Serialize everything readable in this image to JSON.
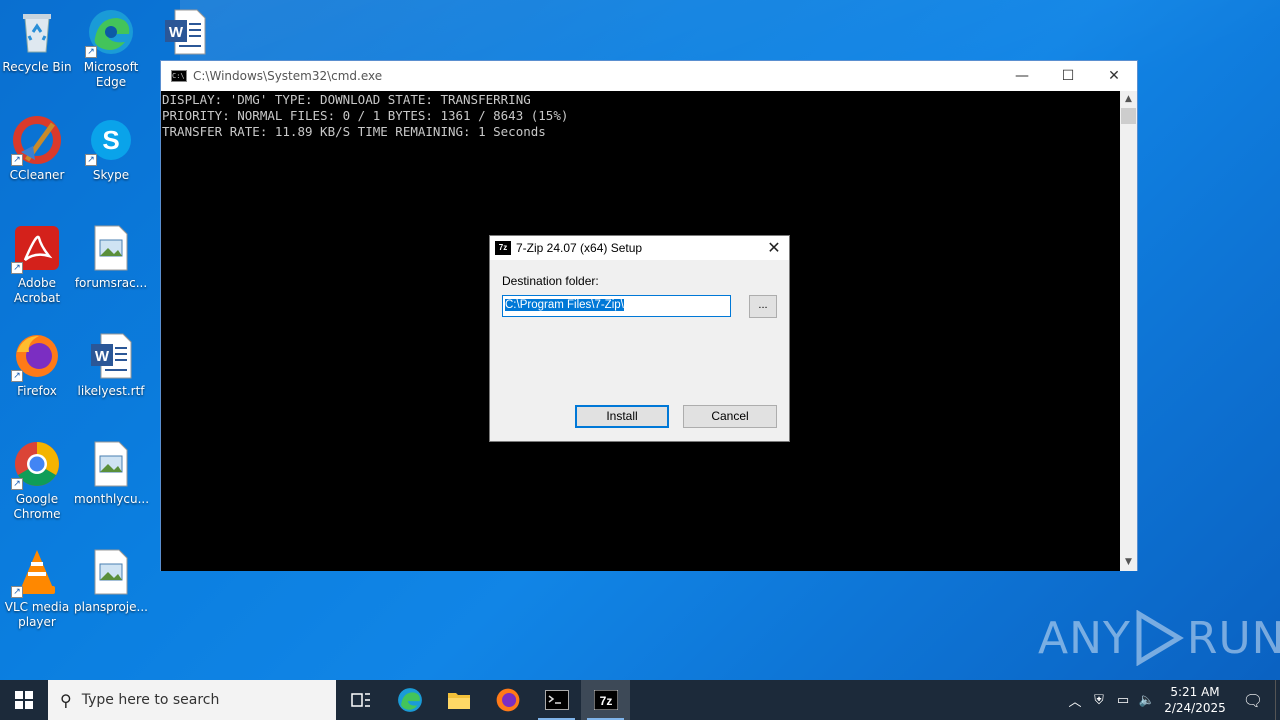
{
  "desktop": {
    "icons": [
      {
        "label": "Recycle Bin",
        "icon": "recycle-bin-icon"
      },
      {
        "label": "Microsoft Edge",
        "icon": "edge-icon"
      },
      {
        "label": "CCleaner",
        "icon": "ccleaner-icon"
      },
      {
        "label": "Skype",
        "icon": "skype-icon"
      },
      {
        "label": "Adobe Acrobat",
        "icon": "acrobat-icon"
      },
      {
        "label": "forumsrac...",
        "icon": "image-file-icon"
      },
      {
        "label": "Firefox",
        "icon": "firefox-icon"
      },
      {
        "label": "likelyest.rtf",
        "icon": "word-doc-icon"
      },
      {
        "label": "Google Chrome",
        "icon": "chrome-icon"
      },
      {
        "label": "monthlycu...",
        "icon": "image-file-icon"
      },
      {
        "label": "VLC media player",
        "icon": "vlc-icon"
      },
      {
        "label": "plansproje...",
        "icon": "image-file-icon"
      }
    ]
  },
  "cmd_window": {
    "title": "C:\\Windows\\System32\\cmd.exe",
    "lines": [
      "DISPLAY: 'DMG' TYPE: DOWNLOAD STATE: TRANSFERRING",
      "PRIORITY: NORMAL FILES: 0 / 1 BYTES: 1361 / 8643 (15%)",
      "TRANSFER RATE: 11.89 KB/S TIME REMAINING: 1 Seconds"
    ],
    "minimize": "—",
    "maximize": "☐",
    "close": "✕"
  },
  "setup_dialog": {
    "title": "7-Zip 24.07 (x64) Setup",
    "icon_text": "7z",
    "destination_label": "Destination folder:",
    "destination_value": "C:\\Program Files\\7-Zip\\",
    "browse_label": "...",
    "install_label": "Install",
    "cancel_label": "Cancel",
    "close": "✕"
  },
  "watermark": {
    "left": "ANY",
    "right": "RUN"
  },
  "taskbar": {
    "search_placeholder": "Type here to search",
    "time": "5:21 AM",
    "date": "2/24/2025"
  }
}
